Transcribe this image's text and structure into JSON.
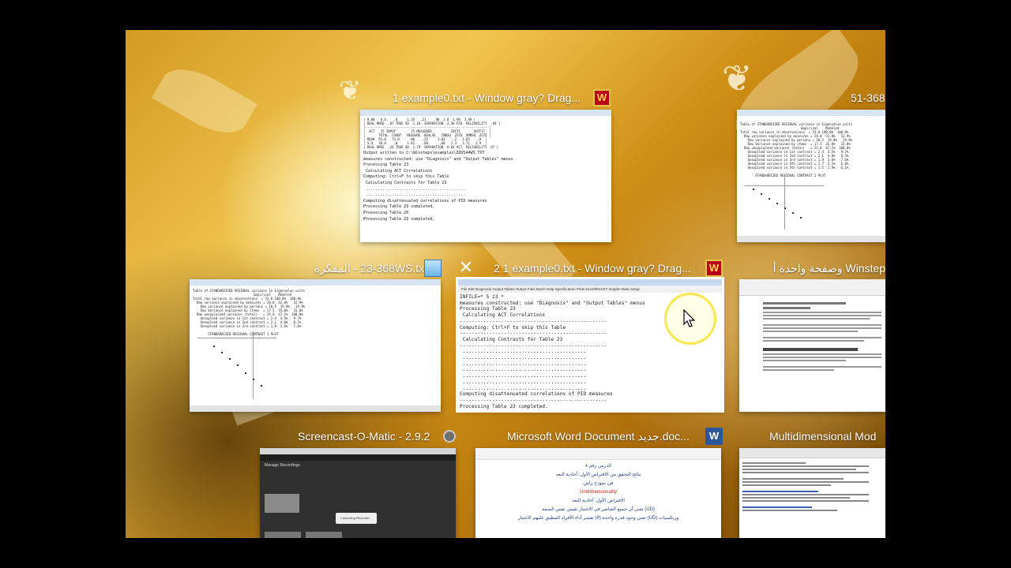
{
  "windows": [
    {
      "title": "1 example0.txt - Window gray? Drag...",
      "icon": "winsteps-icon"
    },
    {
      "title": "51-368",
      "icon": "none"
    },
    {
      "title": "23-368WS.txt - المفكرة",
      "icon": "notepad-icon"
    },
    {
      "title": "2 1 example0.txt - Window gray? Drag...",
      "icon": "winsteps-icon",
      "selected": true
    },
    {
      "title": "Winstep وصفحة واحدة أ",
      "icon": "none"
    },
    {
      "title": "Screencast-O-Matic - 2.9.2",
      "icon": "screencast-icon"
    },
    {
      "title": "Microsoft Word Document جديد.doc...",
      "icon": "word-icon"
    },
    {
      "title": "Multidimensional Mod",
      "icon": "none"
    }
  ],
  "close_glyph": "✕",
  "icon_glyphs": {
    "winsteps": "W",
    "word": "W"
  },
  "thumb_text": {
    "main_lines": [
      "INFILE=* 5 23 *",
      "measures constructed: use \"Diagnosis\" and \"Output Tables\" menus",
      "Processing Table 23",
      " Calculating ACT Correlations",
      "Computing: Ctrl+F to skip this Table",
      " Calculating Contrasts for Table 23",
      "Computing disattenuated correlations of PID measures",
      "Processing Table 23 completed."
    ],
    "menu": "File  Edit  Diagnosis  Output Tables  Output Files  Batch  Help  Specification  Plots  Excel/RSSST  Graphs  Data Setup",
    "win1_lines": [
      "Output written to C:\\Winsteps\\examples\\ZOU544WS.TXT",
      "measures constructed: use \"Diagnosis\" and \"Output Tables\" menus",
      "Processing Table 23",
      " Calculating ACT Correlations",
      "Computing: Ctrl+F to skip this Table",
      " Calculating Contrasts for Table 23",
      "Computing disattenuated correlations of PID measures",
      "Processing Table 23 completed.",
      "Processing Table 26",
      "Processing Table 23 completed."
    ],
    "table_title": "Table of STANDARDIZED RESIDUAL variance in Eigenvalue units",
    "word_heading": "Unidimensionality",
    "word_ar": [
      "الدرس رقم ٨",
      "نتائج التحقق من الافتراض الأول: أحادية البعد",
      "في نموذج راش",
      "الافتراض الأول: أحادية البعد",
      "(UD) تعني أن جميع العناصر في الاختبار تقيس نفس السمة",
      "وريكسيات (UD) تعني وجود قدرة واحدة (θ) تفسر أداء الأفراد المطبق عليهم الاختبار"
    ],
    "sc_label": "Manage Recordings",
    "sc_tile": "Launching Recorder..."
  },
  "colors": {
    "accent_selected": "#ffffff",
    "winsteps_red": "#b8001a",
    "word_blue": "#2b579a",
    "cursor_yellow": "#fae646"
  }
}
